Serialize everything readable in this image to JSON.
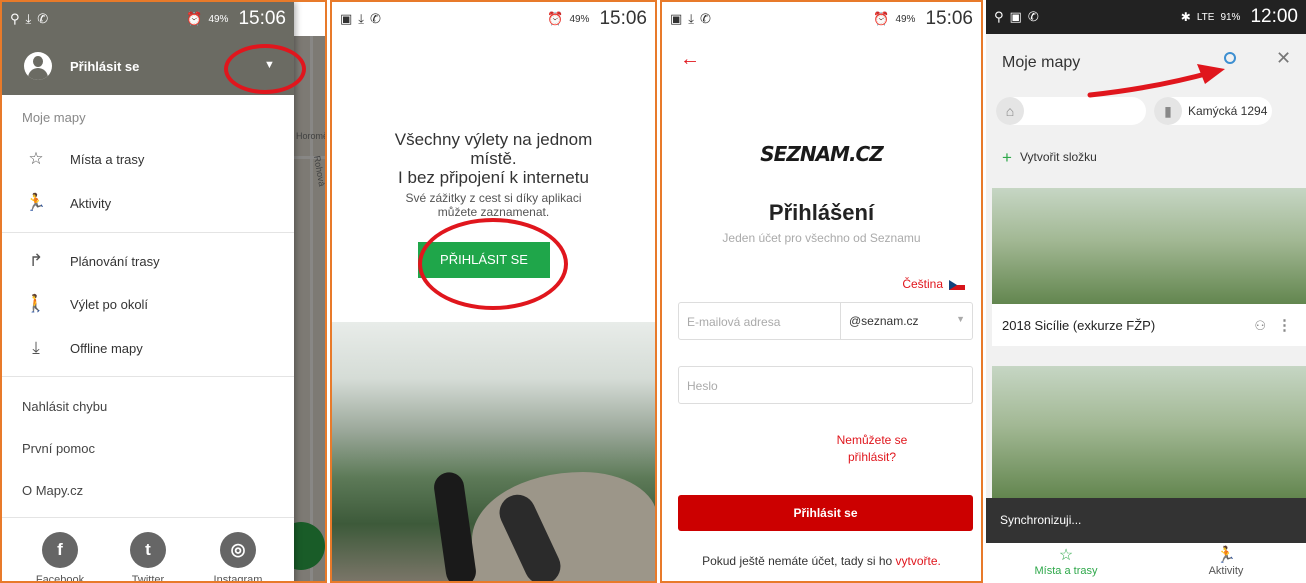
{
  "panel1": {
    "status": {
      "time": "15:06",
      "battery": "49%"
    },
    "header": {
      "login": "Přihlásit se"
    },
    "section_label": "Moje mapy",
    "items": [
      {
        "icon": "star-icon",
        "glyph": "☆",
        "label": "Místa a trasy"
      },
      {
        "icon": "runner-icon",
        "glyph": "🏃",
        "label": "Aktivity"
      },
      {
        "icon": "route-icon",
        "glyph": "↱",
        "label": "Plánování trasy"
      },
      {
        "icon": "hiker-icon",
        "glyph": "🚶",
        "label": "Výlet po okolí"
      },
      {
        "icon": "download-icon",
        "glyph": "⤓",
        "label": "Offline mapy"
      }
    ],
    "links": [
      "Nahlásit chybu",
      "První pomoc",
      "O Mapy.cz"
    ],
    "social": [
      {
        "label": "Facebook",
        "glyph": "f"
      },
      {
        "label": "Twitter",
        "glyph": "t"
      },
      {
        "label": "Instagram",
        "glyph": "◎"
      }
    ],
    "map_labels": {
      "a": "Horomě",
      "b": "Rohová"
    }
  },
  "panel2": {
    "status": {
      "time": "15:06",
      "battery": "49%"
    },
    "headline": [
      "Všechny výlety na jednom",
      "místě.",
      "I bez připojení k internetu"
    ],
    "subline": [
      "Své zážitky z cest si díky aplikaci",
      "můžete zaznamenat."
    ],
    "button": "PŘIHLÁSIT SE"
  },
  "panel3": {
    "status": {
      "time": "15:06",
      "battery": "49%"
    },
    "logo": "SEZNAM.CZ",
    "title": "Přihlášení",
    "subtitle": "Jeden účet pro všechno od Seznamu",
    "language": "Čeština",
    "email_placeholder": "E-mailová adresa",
    "domain": "@seznam.cz",
    "password_placeholder": "Heslo",
    "forgot": [
      "Nemůžete se",
      "přihlásit?"
    ],
    "submit": "Přihlásit se",
    "register_text": "Pokud ještě nemáte účet, tady si ho",
    "register_link": "vytvořte."
  },
  "panel4": {
    "status": {
      "time": "12:00",
      "battery": "91%",
      "network": "LTE"
    },
    "title": "Moje mapy",
    "home_chip": "",
    "work_chip": "Kamýcká 1294",
    "new_folder": "Vytvořit složku",
    "card_title": "2018 Sicílie (exkurze FŽP)",
    "snackbar": "Synchronizuji...",
    "nav": [
      "Místa a trasy",
      "Aktivity"
    ]
  },
  "colors": {
    "accent_red": "#e0161d",
    "green": "#2ea84a",
    "frame": "#e87a2a"
  }
}
